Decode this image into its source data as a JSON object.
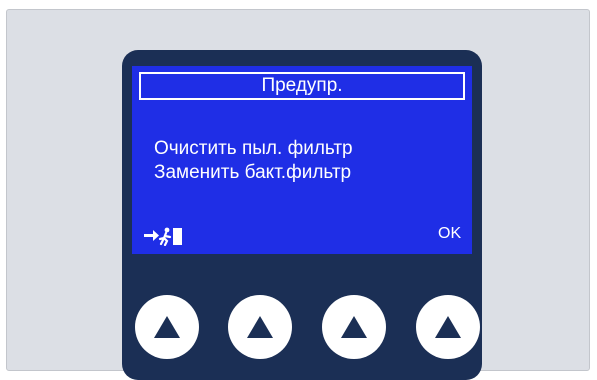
{
  "screen": {
    "title": "Предупр.",
    "messages": [
      "Очистить пыл. фильтр",
      "Заменить бакт.фильтр"
    ],
    "left_softkey_icon": "exit-icon",
    "right_softkey_label": "OK"
  },
  "buttons": [
    {
      "icon": "triangle-up-icon"
    },
    {
      "icon": "triangle-up-icon"
    },
    {
      "icon": "triangle-up-icon"
    },
    {
      "icon": "triangle-up-icon"
    }
  ],
  "colors": {
    "background": "#dcdfe5",
    "device_body": "#1b2f55",
    "screen": "#1f2ee6",
    "text": "#ffffff"
  }
}
